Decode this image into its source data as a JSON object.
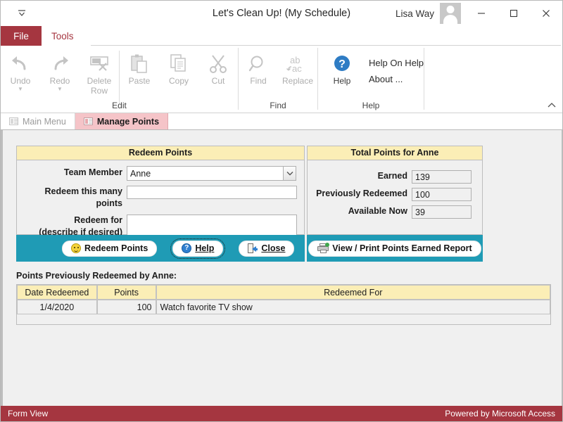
{
  "window": {
    "title": "Let's Clean Up! (My Schedule)",
    "user": "Lisa Way",
    "qat_icon": "customize-quick-access-toolbar-icon",
    "minimize": "minimize-icon",
    "maximize": "maximize-icon",
    "close": "close-icon"
  },
  "ribbon": {
    "tabs": [
      {
        "label": "File",
        "active": true
      },
      {
        "label": "Tools",
        "active": false
      }
    ],
    "groups": [
      {
        "title": "Edit",
        "buttons": [
          {
            "label": "Undo",
            "icon": "undo-arrow-icon",
            "has_caret": true
          },
          {
            "label": "Redo",
            "icon": "redo-arrow-icon",
            "has_caret": true
          },
          {
            "label": "Delete Row",
            "icon": "delete-row-icon",
            "has_caret": false
          },
          {
            "label": "Paste",
            "icon": "clipboard-paste-icon",
            "has_caret": false
          },
          {
            "label": "Copy",
            "icon": "copy-pages-icon",
            "has_caret": false
          },
          {
            "label": "Cut",
            "icon": "scissors-icon",
            "has_caret": false
          }
        ]
      },
      {
        "title": "Find",
        "buttons": [
          {
            "label": "Find",
            "icon": "magnifier-icon",
            "has_caret": false
          },
          {
            "label": "Replace",
            "icon": "ab-ac-replace-icon",
            "has_caret": false
          }
        ]
      },
      {
        "title": "Help",
        "buttons": [
          {
            "label": "Help",
            "icon": "help-question-icon",
            "has_caret": false
          }
        ],
        "links": [
          "Help On Help",
          "About ..."
        ]
      }
    ],
    "collapse_icon": "collapse-ribbon-chevron-icon"
  },
  "document_tabs": [
    {
      "label": "Main Menu",
      "active": false,
      "icon": "form-icon"
    },
    {
      "label": "Manage Points",
      "active": true,
      "icon": "form-icon"
    }
  ],
  "redeem_panel": {
    "header": "Redeem Points",
    "team_member_label": "Team Member",
    "team_member_value": "Anne",
    "team_member_dropdown_icon": "chevron-down-icon",
    "points_label": "Redeem this many points",
    "points_value": "",
    "reason_label_line1": "Redeem for",
    "reason_label_line2": "(describe if desired)",
    "reason_value": "",
    "buttons": [
      {
        "label": "Redeem Points",
        "icon": "smiley-icon",
        "focused": false,
        "accel": ""
      },
      {
        "label": "Help",
        "icon": "help-circle-icon",
        "focused": true,
        "accel": "H"
      },
      {
        "label": "Close",
        "icon": "exit-door-icon",
        "focused": false,
        "accel": "C"
      }
    ]
  },
  "totals_panel": {
    "header": "Total Points for Anne",
    "rows": [
      {
        "label": "Earned",
        "value": "139"
      },
      {
        "label": "Previously Redeemed",
        "value": "100"
      },
      {
        "label": "Available Now",
        "value": "39"
      }
    ],
    "report_button": {
      "label": "View / Print Points Earned Report",
      "icon": "printer-icon"
    }
  },
  "history": {
    "caption": "Points Previously Redeemed by Anne:",
    "columns": [
      "Date Redeemed",
      "Points",
      "Redeemed For"
    ],
    "rows": [
      {
        "date": "1/4/2020",
        "points": "100",
        "reason": "Watch favorite TV show"
      }
    ]
  },
  "statusbar": {
    "left": "Form View",
    "right": "Powered by Microsoft Access"
  },
  "colors": {
    "accent_red": "#a53640",
    "teal": "#1f9bb5",
    "panel_header_yellow": "#fbeeb6",
    "tab_active_pink": "#f5c4c8",
    "canvas_gray": "#f0f0f0"
  }
}
